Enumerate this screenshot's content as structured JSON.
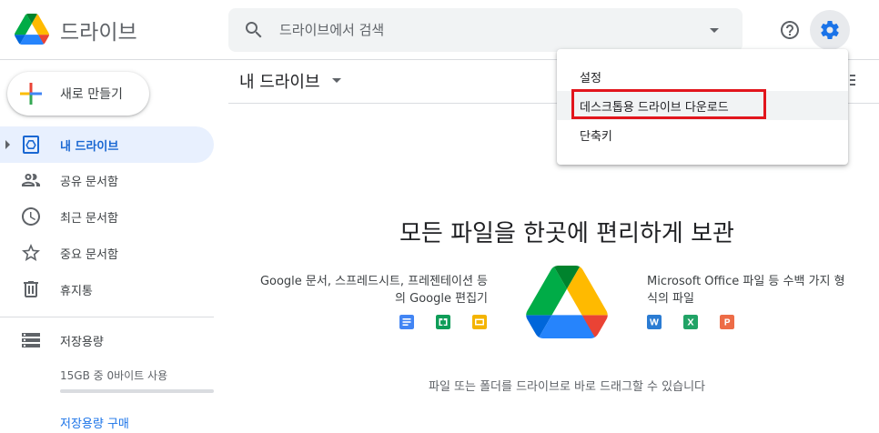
{
  "app": {
    "title": "드라이브"
  },
  "search": {
    "placeholder": "드라이브에서 검색"
  },
  "sidebar": {
    "new_label": "새로 만들기",
    "items": [
      {
        "label": "내 드라이브",
        "icon": "my-drive-icon",
        "active": true
      },
      {
        "label": "공유 문서함",
        "icon": "people-icon"
      },
      {
        "label": "최근 문서함",
        "icon": "clock-icon"
      },
      {
        "label": "중요 문서함",
        "icon": "star-icon"
      },
      {
        "label": "휴지통",
        "icon": "trash-icon"
      },
      {
        "label": "저장용량",
        "icon": "storage-icon"
      }
    ],
    "storage_usage": "15GB 중 0바이트 사용",
    "storage_fraction": 0,
    "buy_storage": "저장용량 구매"
  },
  "main": {
    "title": "내 드라이브",
    "hero_title": "모든 파일을 한곳에 편리하게 보관",
    "left_desc_line1": "Google 문서, 스프레드시트, 프레젠테이션 등",
    "left_desc_line2": "의 Google 편집기",
    "right_desc_line1": "Microsoft Office 파일 등 수백 가지 형",
    "right_desc_line2": "식의 파일",
    "drop_hint": "파일 또는 폴더를 드라이브로 바로 드래그할 수 있습니다"
  },
  "settings_menu": {
    "items": [
      {
        "label": "설정"
      },
      {
        "label": "데스크톱용 드라이브 다운로드",
        "highlighted": true
      },
      {
        "label": "단축키"
      }
    ]
  },
  "colors": {
    "accent": "#1a73e8",
    "active_bg": "#e8f0fe",
    "highlight_border": "#e2151c",
    "docs": "#4285f4",
    "sheets": "#0f9d58",
    "slides": "#f4b400",
    "word": "#2b7cd3",
    "excel": "#21a366",
    "powerpoint": "#ed6c47"
  }
}
